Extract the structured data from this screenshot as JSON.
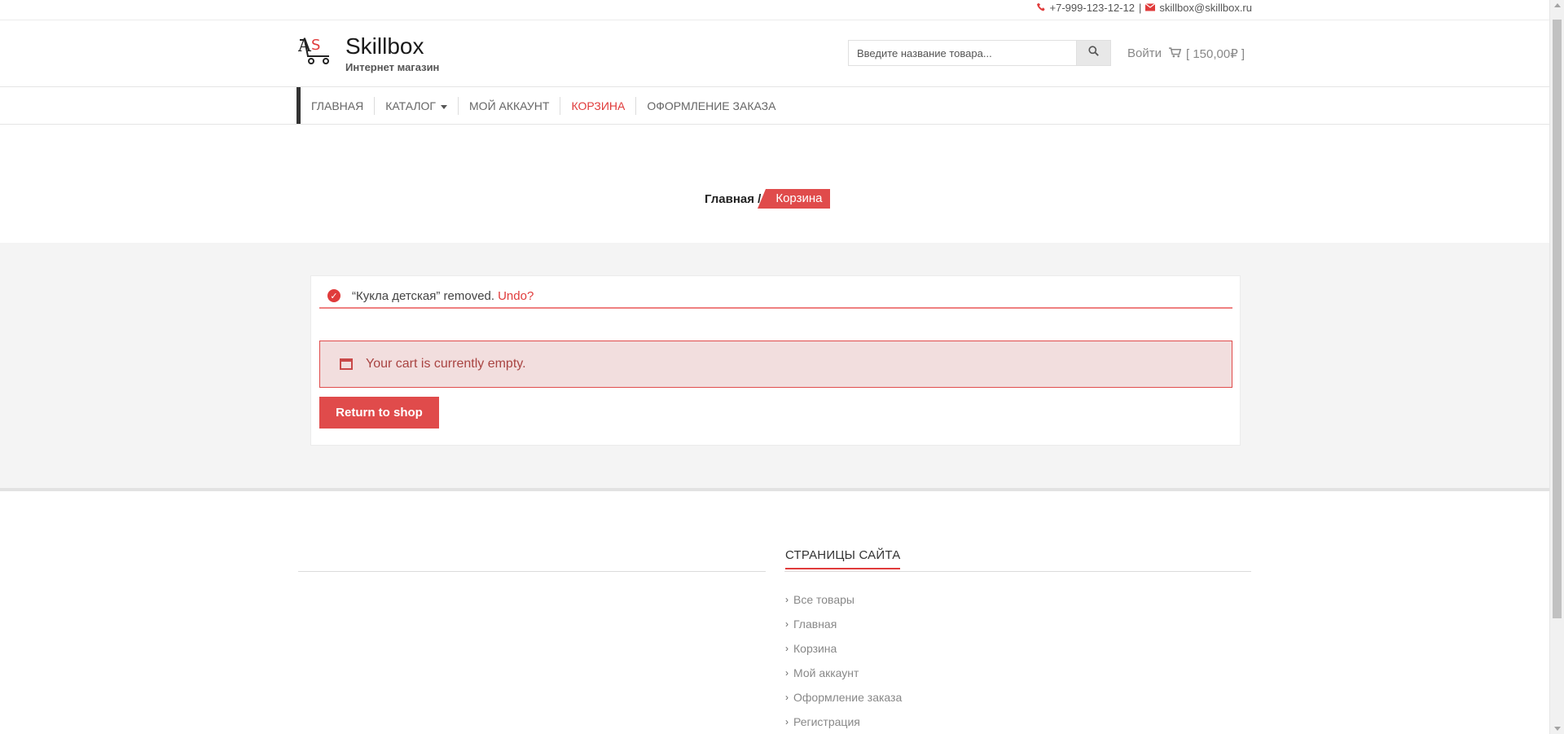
{
  "topbar": {
    "phone": "+7-999-123-12-12",
    "separator": "|",
    "email": "skillbox@skillbox.ru"
  },
  "header": {
    "logo_title": "Skillbox",
    "logo_subtitle": "Интернет магазин",
    "search_placeholder": "Введите название товара...",
    "login_label": "Войти",
    "cart_label": "[ 150,00₽ ]"
  },
  "nav": {
    "items": [
      {
        "label": "ГЛАВНАЯ",
        "active": false
      },
      {
        "label": "КАТАЛОГ",
        "active": false,
        "dropdown": true
      },
      {
        "label": "МОЙ АККАУНТ",
        "active": false
      },
      {
        "label": "КОРЗИНА",
        "active": true
      },
      {
        "label": "ОФОРМЛЕНИЕ ЗАКАЗА",
        "active": false
      }
    ]
  },
  "breadcrumb": {
    "home": "Главная /",
    "current": "Корзина"
  },
  "notice": {
    "message": "“Кукла детская” removed.",
    "undo": "Undo?"
  },
  "cart": {
    "empty_message": "Your cart is currently empty.",
    "return_button": "Return to shop"
  },
  "footer": {
    "title": "СТРАНИЦЫ САЙТА",
    "links": [
      "Все товары",
      "Главная",
      "Корзина",
      "Мой аккаунт",
      "Оформление заказа",
      "Регистрация"
    ]
  },
  "colors": {
    "accent": "#e03b3b",
    "band_background": "#f4f4f4",
    "error_background": "#f2dede"
  }
}
